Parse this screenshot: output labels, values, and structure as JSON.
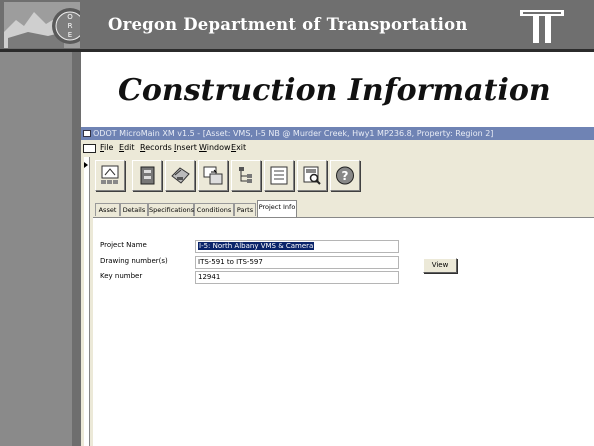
{
  "header": {
    "org_title": "Oregon Department of Transportation",
    "slide_title": "Construction Information"
  },
  "app": {
    "window_title": "ODOT MicroMain XM v1.5 - [Asset: VMS, I-5 NB @ Murder Creek, Hwy1 MP236.8, Property: Region 2]",
    "menu": [
      "File",
      "Edit",
      "Records",
      "Insert",
      "Window",
      "Exit"
    ],
    "toolbar_icons": [
      "form-view-icon",
      "book-icon",
      "printer-icon",
      "export-icon",
      "hierarchy-icon",
      "list-icon",
      "report-icon",
      "help-icon"
    ],
    "tabs": [
      "Asset",
      "Details",
      "Specifications",
      "Conditions",
      "Parts",
      "Project Info"
    ],
    "active_tab": "Project Info",
    "fields": {
      "project_name": {
        "label": "Project Name",
        "value": "I-5: North Albany VMS & Camera"
      },
      "drawing_numbers": {
        "label": "Drawing number(s)",
        "value": "ITS-591 to ITS-597"
      },
      "key_number": {
        "label": "Key number",
        "value": "12941"
      }
    },
    "view_button": "View"
  },
  "colors": {
    "banner": "#6f6f6f",
    "title_bar": "#6f83b4",
    "window_face": "#ece9d8",
    "selection": "#0a246a"
  }
}
